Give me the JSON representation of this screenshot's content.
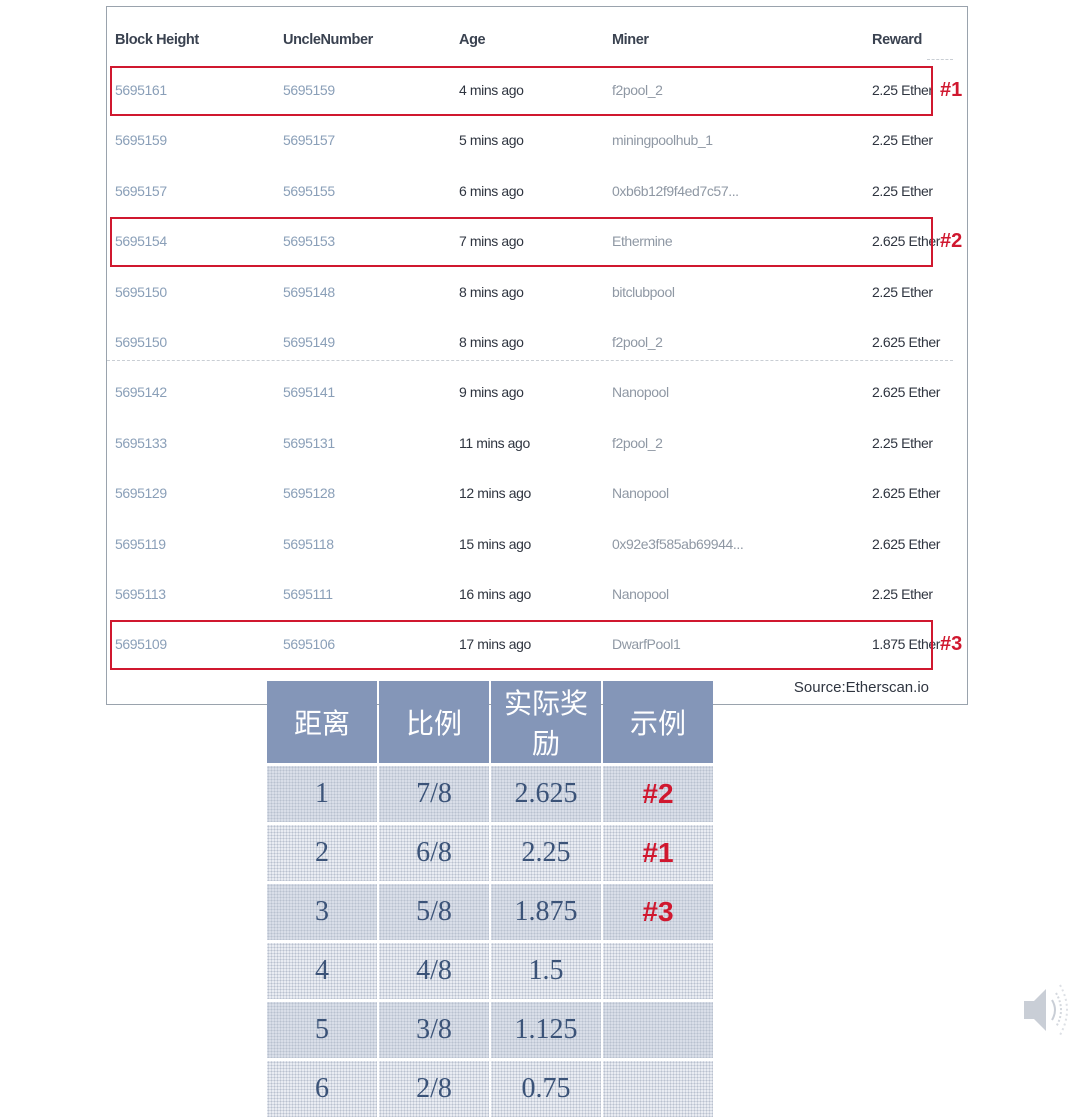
{
  "uncles": {
    "headers": [
      "Block Height",
      "UncleNumber",
      "Age",
      "Miner",
      "Reward"
    ],
    "rows": [
      {
        "block": "5695161",
        "uncle": "5695159",
        "age": "4 mins ago",
        "miner": "f2pool_2",
        "reward": "2.25 Ether"
      },
      {
        "block": "5695159",
        "uncle": "5695157",
        "age": "5 mins ago",
        "miner": "miningpoolhub_1",
        "reward": "2.25 Ether"
      },
      {
        "block": "5695157",
        "uncle": "5695155",
        "age": "6 mins ago",
        "miner": "0xb6b12f9f4ed7c57...",
        "reward": "2.25 Ether"
      },
      {
        "block": "5695154",
        "uncle": "5695153",
        "age": "7 mins ago",
        "miner": "Ethermine",
        "reward": "2.625 Ether"
      },
      {
        "block": "5695150",
        "uncle": "5695148",
        "age": "8 mins ago",
        "miner": "bitclubpool",
        "reward": "2.25 Ether"
      },
      {
        "block": "5695150",
        "uncle": "5695149",
        "age": "8 mins ago",
        "miner": "f2pool_2",
        "reward": "2.625 Ether"
      },
      {
        "block": "5695142",
        "uncle": "5695141",
        "age": "9 mins ago",
        "miner": "Nanopool",
        "reward": "2.625 Ether"
      },
      {
        "block": "5695133",
        "uncle": "5695131",
        "age": "11 mins ago",
        "miner": "f2pool_2",
        "reward": "2.25 Ether"
      },
      {
        "block": "5695129",
        "uncle": "5695128",
        "age": "12 mins ago",
        "miner": "Nanopool",
        "reward": "2.625 Ether"
      },
      {
        "block": "5695119",
        "uncle": "5695118",
        "age": "15 mins ago",
        "miner": "0x92e3f585ab69944...",
        "reward": "2.625 Ether"
      },
      {
        "block": "5695113",
        "uncle": "5695111",
        "age": "16 mins ago",
        "miner": "Nanopool",
        "reward": "2.25 Ether"
      },
      {
        "block": "5695109",
        "uncle": "5695106",
        "age": "17 mins ago",
        "miner": "DwarfPool1",
        "reward": "1.875 Ether"
      }
    ],
    "highlights": [
      {
        "row": 0,
        "tag": "#1"
      },
      {
        "row": 3,
        "tag": "#2"
      },
      {
        "row": 11,
        "tag": "#3"
      }
    ],
    "source": "Source:Etherscan.io"
  },
  "ratio_table": {
    "headers": [
      "距离",
      "比例",
      "实际奖励",
      "示例"
    ],
    "rows": [
      {
        "distance": "1",
        "ratio": "7/8",
        "reward": "2.625",
        "example": "#2"
      },
      {
        "distance": "2",
        "ratio": "6/8",
        "reward": "2.25",
        "example": "#1"
      },
      {
        "distance": "3",
        "ratio": "5/8",
        "reward": "1.875",
        "example": "#3"
      },
      {
        "distance": "4",
        "ratio": "4/8",
        "reward": "1.5",
        "example": ""
      },
      {
        "distance": "5",
        "ratio": "3/8",
        "reward": "1.125",
        "example": ""
      },
      {
        "distance": "6",
        "ratio": "2/8",
        "reward": "0.75",
        "example": ""
      }
    ]
  },
  "icons": {
    "speaker": "speaker-icon"
  },
  "colors": {
    "highlight": "#d0182f",
    "table_header": "#8496b8",
    "link": "#8a9fb8"
  }
}
